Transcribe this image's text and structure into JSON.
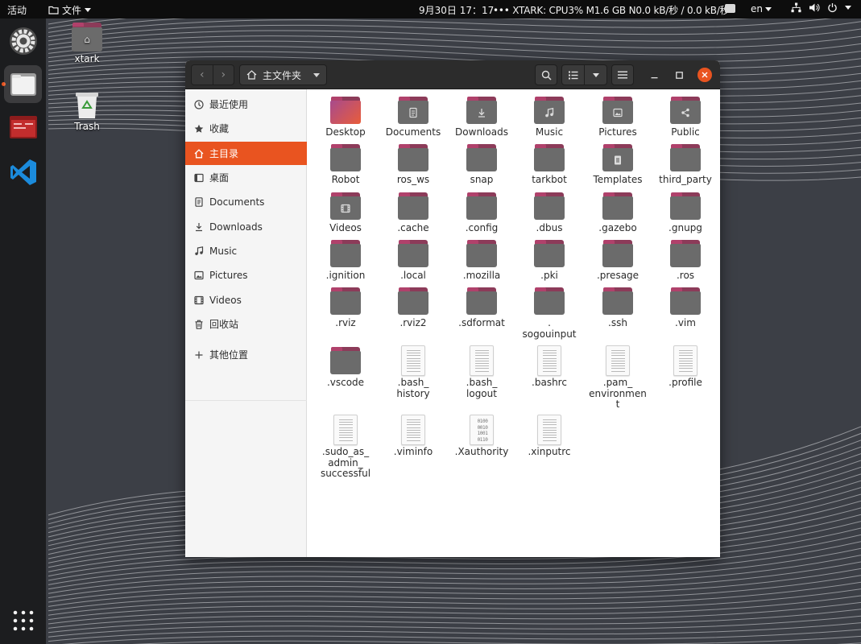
{
  "topbar": {
    "activities": "活动",
    "app_menu": "文件",
    "clock": "9月30日 17：17",
    "sysmon": "••• XTARK: CPU3%  M1.6 GB  N0.0 kB/秒 / 0.0 kB/秒",
    "language": "en"
  },
  "desktop": {
    "icons": [
      {
        "label": "xtark"
      },
      {
        "label": "Trash"
      }
    ]
  },
  "window": {
    "path_label": "主文件夹",
    "sidebar": [
      {
        "label": "最近使用",
        "icon": "clock-icon"
      },
      {
        "label": "收藏",
        "icon": "star-icon"
      },
      {
        "label": "主目录",
        "icon": "home-icon"
      },
      {
        "label": "桌面",
        "icon": "desktop-icon"
      },
      {
        "label": "Documents",
        "icon": "document-icon"
      },
      {
        "label": "Downloads",
        "icon": "download-icon"
      },
      {
        "label": "Music",
        "icon": "music-icon"
      },
      {
        "label": "Pictures",
        "icon": "picture-icon"
      },
      {
        "label": "Videos",
        "icon": "video-icon"
      },
      {
        "label": "回收站",
        "icon": "trash-icon"
      },
      {
        "label": "其他位置",
        "icon": "plus-icon"
      }
    ],
    "files": [
      {
        "name": "Desktop",
        "kind": "folder-desktop"
      },
      {
        "name": "Documents",
        "kind": "folder-documents"
      },
      {
        "name": "Downloads",
        "kind": "folder-downloads"
      },
      {
        "name": "Music",
        "kind": "folder-music"
      },
      {
        "name": "Pictures",
        "kind": "folder-pictures"
      },
      {
        "name": "Public",
        "kind": "folder-public"
      },
      {
        "name": "Robot",
        "kind": "folder"
      },
      {
        "name": "ros_ws",
        "kind": "folder"
      },
      {
        "name": "snap",
        "kind": "folder"
      },
      {
        "name": "tarkbot",
        "kind": "folder"
      },
      {
        "name": "Templates",
        "kind": "folder-templates"
      },
      {
        "name": "third_party",
        "kind": "folder"
      },
      {
        "name": "Videos",
        "kind": "folder-videos"
      },
      {
        "name": ".cache",
        "kind": "folder"
      },
      {
        "name": ".config",
        "kind": "folder"
      },
      {
        "name": ".dbus",
        "kind": "folder"
      },
      {
        "name": ".gazebo",
        "kind": "folder"
      },
      {
        "name": ".gnupg",
        "kind": "folder"
      },
      {
        "name": ".ignition",
        "kind": "folder"
      },
      {
        "name": ".local",
        "kind": "folder"
      },
      {
        "name": ".mozilla",
        "kind": "folder"
      },
      {
        "name": ".pki",
        "kind": "folder"
      },
      {
        "name": ".presage",
        "kind": "folder"
      },
      {
        "name": ".ros",
        "kind": "folder"
      },
      {
        "name": ".rviz",
        "kind": "folder"
      },
      {
        "name": ".rviz2",
        "kind": "folder"
      },
      {
        "name": ".sdformat",
        "kind": "folder"
      },
      {
        "name": ".\nsogouinput",
        "kind": "folder"
      },
      {
        "name": ".ssh",
        "kind": "folder"
      },
      {
        "name": ".vim",
        "kind": "folder"
      },
      {
        "name": ".vscode",
        "kind": "folder"
      },
      {
        "name": ".bash_\nhistory",
        "kind": "text"
      },
      {
        "name": ".bash_\nlogout",
        "kind": "text"
      },
      {
        "name": ".bashrc",
        "kind": "text"
      },
      {
        "name": ".pam_\nenvironmen\nt",
        "kind": "text"
      },
      {
        "name": ".profile",
        "kind": "text"
      },
      {
        "name": ".sudo_as_\nadmin_\nsuccessful",
        "kind": "text"
      },
      {
        "name": ".viminfo",
        "kind": "text"
      },
      {
        "name": ".Xauthority",
        "kind": "binary"
      },
      {
        "name": ".xinputrc",
        "kind": "text"
      }
    ]
  },
  "colors": {
    "accent": "#e95420",
    "folder_front": "#6b6b6b",
    "folder_back": "#8c3b59",
    "headerbar": "#2c2c2c"
  }
}
